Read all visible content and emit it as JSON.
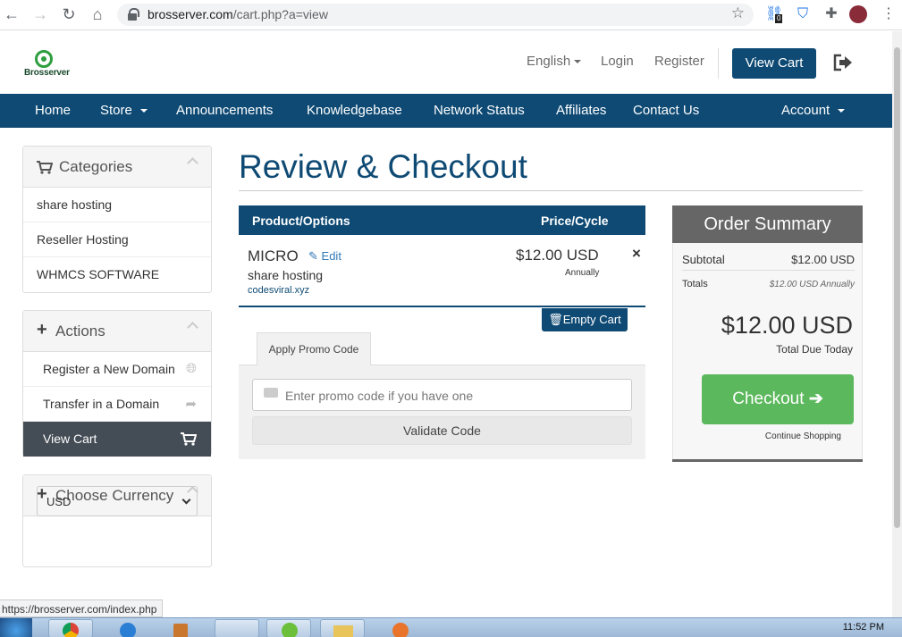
{
  "browser": {
    "url_host": "brosserver.com",
    "url_path": "/cart.php?a=view",
    "ext_badge": "0"
  },
  "header": {
    "logo_text": "Brosserver",
    "language": "English",
    "login": "Login",
    "register": "Register",
    "view_cart": "View Cart"
  },
  "nav": {
    "items": [
      "Home",
      "Store",
      "Announcements",
      "Knowledgebase",
      "Network Status",
      "Affiliates",
      "Contact Us"
    ],
    "account": "Account"
  },
  "sidebar": {
    "categories_title": "Categories",
    "categories": [
      "share hosting",
      "Reseller Hosting",
      "WHMCS SOFTWARE"
    ],
    "actions_title": "Actions",
    "actions": [
      "Register a New Domain",
      "Transfer in a Domain",
      "View Cart"
    ],
    "currency_title": "Choose Currency",
    "currency_value": "USD"
  },
  "main": {
    "title": "Review & Checkout",
    "col_product": "Product/Options",
    "col_price": "Price/Cycle",
    "item": {
      "name": "MICRO",
      "edit": "Edit",
      "group": "share hosting",
      "domain": "codesviral.xyz",
      "price": "$12.00 USD",
      "cycle": "Annually",
      "remove": "×"
    },
    "empty_cart": "Empty Cart",
    "promo_tab": "Apply Promo Code",
    "promo_placeholder": "Enter promo code if you have one",
    "validate": "Validate Code"
  },
  "summary": {
    "title": "Order Summary",
    "subtotal_label": "Subtotal",
    "subtotal_value": "$12.00 USD",
    "totals_label": "Totals",
    "totals_value": "$12.00 USD Annually",
    "total_due": "$12.00 USD",
    "total_due_label": "Total Due Today",
    "checkout": "Checkout",
    "continue": "Continue Shopping"
  },
  "status": {
    "hover_url": "https://brosserver.com/index.php",
    "clock": "11:52 PM"
  },
  "colors": {
    "brand": "#0e4a74",
    "checkout": "#5cb85c"
  }
}
